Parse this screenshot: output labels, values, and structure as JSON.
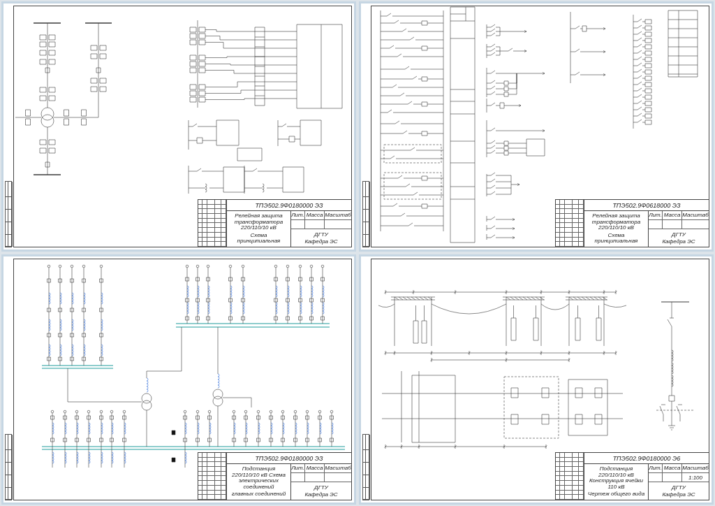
{
  "sheets": [
    {
      "kind": "protection",
      "title_block": {
        "code": "ТПЭ502.9Ф0180000 ЭЗ",
        "title": "Релейная защита трансформатора 220/110/10 кВ",
        "subtitle": "Схема принципиальная",
        "headers": [
          "Лит.",
          "Масса",
          "Масштаб"
        ],
        "organization": "ДГТУ",
        "department": "Кафедра ЭС"
      }
    },
    {
      "kind": "logic",
      "title_block": {
        "code": "ТПЭ502.9Ф0618000 ЭЗ",
        "title": "Релейная защита трансформатора 220/110/10 кВ",
        "subtitle": "Схема принципиальная",
        "headers": [
          "Лит.",
          "Масса",
          "Масштаб"
        ],
        "organization": "ДГТУ",
        "department": "Кафедра ЭС"
      }
    },
    {
      "kind": "substation",
      "title_block": {
        "code": "ТПЭ502.9Ф0180000 ЭЗ",
        "title": "Подстанция 220/110/10 кВ Схема электрических соединений",
        "subtitle": "главных соединений",
        "headers": [
          "Лит.",
          "Масса",
          "Масштаб"
        ],
        "organization": "ДГТУ",
        "department": "Кафедра ЭС"
      }
    },
    {
      "kind": "layout",
      "title_block": {
        "code": "ТПЭ502.9Ф0180000 Э6",
        "title": "Подстанция 220/110/10 кВ Конструкция ячейки 110 кВ",
        "subtitle": "Чертеж общего вида",
        "headers": [
          "Лит.",
          "Масса",
          "Масштаб"
        ],
        "scale": "1:100",
        "organization": "ДГТУ",
        "department": "Кафедра ЭС"
      }
    }
  ]
}
